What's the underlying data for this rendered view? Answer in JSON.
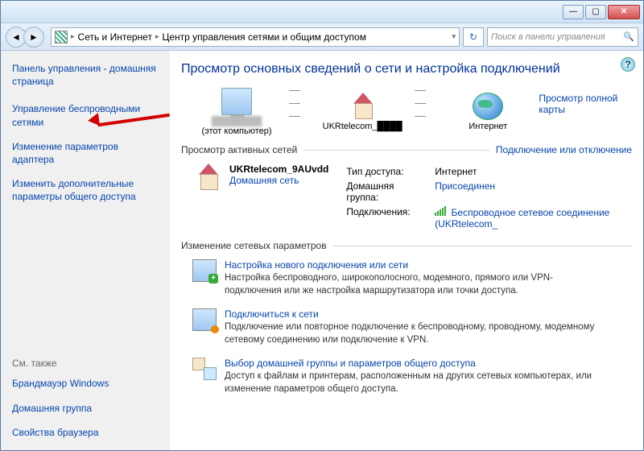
{
  "titlebar": {
    "min": "—",
    "max": "▢",
    "close": "✕"
  },
  "breadcrumb": {
    "item1": "Сеть и Интернет",
    "item2": "Центр управления сетями и общим доступом"
  },
  "search": {
    "placeholder": "Поиск в панели управления"
  },
  "sidebar": {
    "home": "Панель управления - домашняя страница",
    "links": [
      "Управление беспроводными сетями",
      "Изменение параметров адаптера",
      "Изменить дополнительные параметры общего доступа"
    ],
    "see_also": "См. также",
    "footer": [
      "Брандмауэр Windows",
      "Домашняя группа",
      "Свойства браузера"
    ]
  },
  "main": {
    "title": "Просмотр основных сведений о сети и настройка подключений",
    "map_link": "Просмотр полной карты",
    "nodes": {
      "pc_name": "████████",
      "pc_sub": "(этот компьютер)",
      "net_name": "UKRtelecom_████",
      "internet": "Интернет"
    },
    "active_header": "Просмотр активных сетей",
    "active_action": "Подключение или отключение",
    "active_net": {
      "name": "UKRtelecom_9AUvdd",
      "type": "Домашняя сеть",
      "props": {
        "access_label": "Тип доступа:",
        "access_value": "Интернет",
        "homegroup_label": "Домашняя группа:",
        "homegroup_value": "Присоединен",
        "conn_label": "Подключения:",
        "conn_value": "Беспроводное сетевое соединение (UKRtelecom_"
      }
    },
    "change_header": "Изменение сетевых параметров",
    "tasks": [
      {
        "title": "Настройка нового подключения или сети",
        "desc": "Настройка беспроводного, широкополосного, модемного, прямого или VPN-подключения или же настройка маршрутизатора или точки доступа."
      },
      {
        "title": "Подключиться к сети",
        "desc": "Подключение или повторное подключение к беспроводному, проводному, модемному сетевому соединению или подключение к VPN."
      },
      {
        "title": "Выбор домашней группы и параметров общего доступа",
        "desc": "Доступ к файлам и принтерам, расположенным на других сетевых компьютерах, или изменение параметров общего доступа."
      }
    ]
  }
}
